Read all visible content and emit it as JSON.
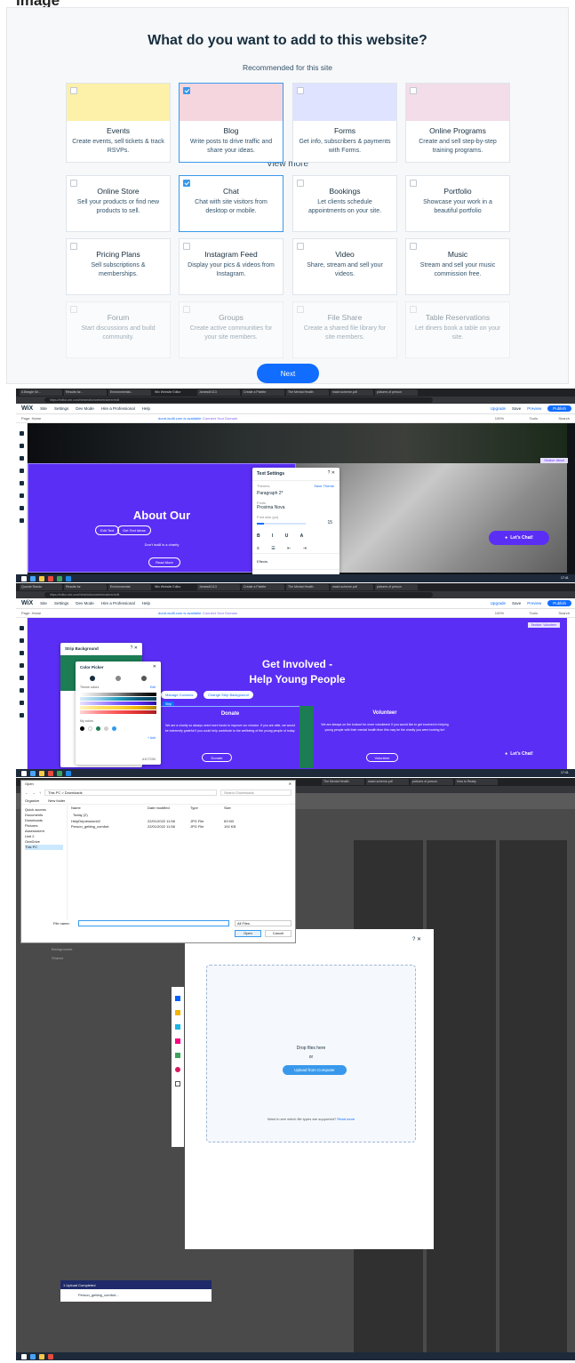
{
  "doc_title": "Image",
  "panel1": {
    "heading": "What do you want to add to this website?",
    "recommended_label": "Recommended for this site",
    "view_more_label": "View more",
    "next_label": "Next",
    "recommended": [
      {
        "title": "Events",
        "desc": "Create events, sell tickets & track RSVPs.",
        "selected": false
      },
      {
        "title": "Blog",
        "desc": "Write posts to drive traffic and share your ideas.",
        "selected": true
      },
      {
        "title": "Forms",
        "desc": "Get info, subscribers & payments with Forms.",
        "selected": false
      },
      {
        "title": "Online Programs",
        "desc": "Create and sell step-by-step training programs.",
        "selected": false
      }
    ],
    "more": [
      {
        "title": "Online Store",
        "desc": "Sell your products or find new products to sell.",
        "selected": false
      },
      {
        "title": "Chat",
        "desc": "Chat with site visitors from desktop or mobile.",
        "selected": true
      },
      {
        "title": "Bookings",
        "desc": "Let clients schedule appointments on your site.",
        "selected": false
      },
      {
        "title": "Portfolio",
        "desc": "Showcase your work in a beautiful portfolio",
        "selected": false
      },
      {
        "title": "Pricing Plans",
        "desc": "Sell subscriptions & memberships.",
        "selected": false
      },
      {
        "title": "Instagram Feed",
        "desc": "Display your pics & videos from Instagram.",
        "selected": false
      },
      {
        "title": "Video",
        "desc": "Share, stream and sell your videos.",
        "selected": false
      },
      {
        "title": "Music",
        "desc": "Stream and sell your music commission free.",
        "selected": false
      },
      {
        "title": "Forum",
        "desc": "Start discussions and build community.",
        "selected": false
      },
      {
        "title": "Groups",
        "desc": "Create active communities for your site members.",
        "selected": false
      },
      {
        "title": "File Share",
        "desc": "Create a shared file library for site members.",
        "selected": false
      },
      {
        "title": "Table Reservations",
        "desc": "Let diners book a table on your site.",
        "selected": false
      }
    ]
  },
  "editor": {
    "logo": "WiX",
    "menu": [
      "Site",
      "Settings",
      "Dev Mode",
      "Hire a Professional",
      "Help"
    ],
    "right": [
      "Upgrade",
      "Save",
      "Preview",
      "Publish"
    ],
    "page_label": "Page: Home",
    "domain_text": "dorot-isol8.com is available.",
    "connect_domain": "Connect Your Domain",
    "zoom": "100%",
    "tools": "Tools",
    "search": "Search",
    "chat_label": "Let's Chat!",
    "time": "17:41",
    "date": "22/01/2022"
  },
  "panel2": {
    "section_title": "About Our",
    "section_text": "Don't isol8 is a charity",
    "read_more": "Read More",
    "edit_text": "Edit Text",
    "get_text_ideas": "Get Text Ideas",
    "strip_label": "Section: About",
    "text_settings": {
      "title": "Text Settings",
      "themes_label": "Themes",
      "save_theme": "Save Theme",
      "theme_value": "Paragraph 2*",
      "fonts_label": "Fonts",
      "font_value": "Proxima Nova",
      "font_size_label": "Font size (px)",
      "font_size_value": "15",
      "effects": "Effects",
      "char_spacing": "Character & line spacing"
    }
  },
  "panel3": {
    "heading_line1": "Get Involved -",
    "heading_line2": "Help Young People",
    "manage_columns": "Manage Columns",
    "change_strip_bg": "Change Strip Background",
    "strip_tag": "Strip",
    "section_label": "Section: Volunteer",
    "donate_title": "Donate",
    "donate_text": "We are a charity so always need more funds to improve our mission. If you are able, we would be extremely grateful if you could help contribute to the wellbeing of the young people of today.",
    "donate_btn": "Donate",
    "volunteer_title": "Volunteer",
    "volunteer_text": "We are always on the lookout for more volunteers! If you would like to get involved in helping young people with their mental health then this may be the charity you were looking for!",
    "volunteer_btn": "Volunteer",
    "strip_bg_dialog": {
      "title": "Strip Background",
      "settings": "Settings"
    },
    "color_picker": {
      "title": "Color Picker",
      "theme_colors": "Theme colors",
      "edit": "Edit",
      "my_colors": "My colors",
      "add": "+ Add",
      "hex": "#1C7C54"
    }
  },
  "panel4": {
    "dialog_title": "Open",
    "path": "This PC  >  Downloads",
    "search_placeholder": "Search Downloads",
    "organize": "Organize",
    "new_folder": "New folder",
    "columns": [
      "Name",
      "Date modified",
      "Type",
      "Size"
    ],
    "group": "Today (2)",
    "files": [
      {
        "name": "HelpDepressionb2",
        "date": "22/01/2022 11:58",
        "type": "JPG File",
        "size": "63 KB"
      },
      {
        "name": "Person_getting_comfort",
        "date": "22/01/2022 11:58",
        "type": "JPG File",
        "size": "192 KB"
      }
    ],
    "nav": [
      "Quick access",
      "Documents",
      "Downloads",
      "Pictures",
      "Assessment",
      "Unit 2",
      "OneDrive",
      "This PC"
    ],
    "file_name_label": "File name:",
    "file_type": "All Files",
    "open_btn": "Open",
    "cancel_btn": "Cancel",
    "upload_drop": "Drop files here",
    "upload_or": "or",
    "upload_btn": "Upload from Computer",
    "upload_help": "Want to see which file types are supported?",
    "read_more": "Read more",
    "upload_status": "1 Upload Completed",
    "upload_file": "Person_getting_comfort...",
    "left_items": [
      "Backgrounds",
      "Shared"
    ]
  }
}
